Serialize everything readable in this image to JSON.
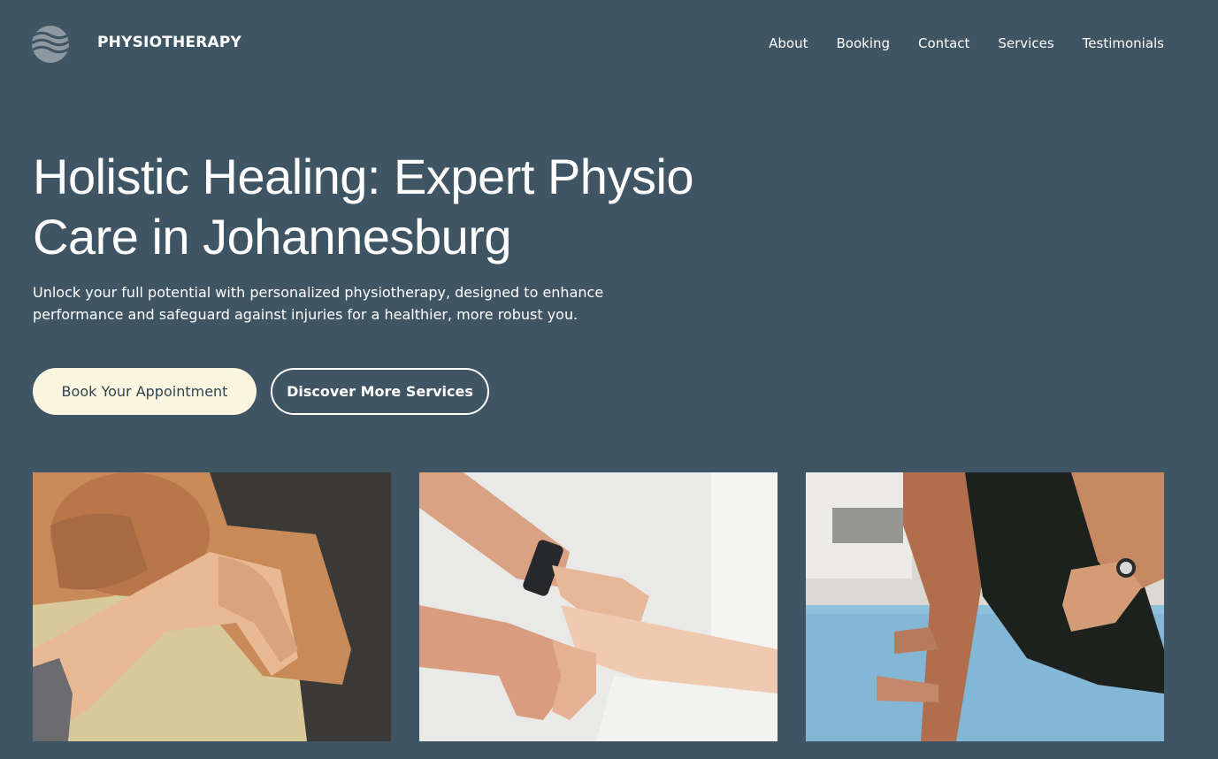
{
  "header": {
    "brand": "PHYSIOTHERAPY",
    "logo_icon": "wave-logo-icon",
    "nav": [
      {
        "label": "About"
      },
      {
        "label": "Booking"
      },
      {
        "label": "Contact"
      },
      {
        "label": "Services"
      },
      {
        "label": "Testimonials"
      }
    ]
  },
  "hero": {
    "title": "Holistic Healing: Expert Physio Care in Johannesburg",
    "subtitle": "Unlock your full potential with personalized physiotherapy, designed to enhance performance and safeguard against injuries for a healthier, more robust you.",
    "primary_button": "Book Your Appointment",
    "secondary_button": "Discover More Services"
  },
  "gallery": [
    {
      "subject": "neck-massage-photo"
    },
    {
      "subject": "wrist-therapy-photo"
    },
    {
      "subject": "exercise-assist-photo"
    }
  ],
  "colors": {
    "background": "#3f5563",
    "primary_button_bg": "#fbf6df",
    "primary_button_text": "#2f4350",
    "text": "#ffffff"
  }
}
